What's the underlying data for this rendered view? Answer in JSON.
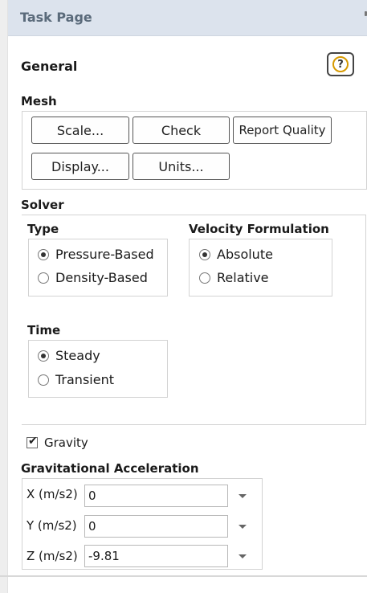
{
  "panel": {
    "title": "Task Page"
  },
  "general": {
    "title": "General",
    "help_symbol": "?"
  },
  "mesh": {
    "title": "Mesh",
    "buttons": [
      "Scale...",
      "Check",
      "Report Quality",
      "Display...",
      "Units..."
    ]
  },
  "solver": {
    "title": "Solver",
    "type": {
      "title": "Type",
      "options": [
        "Pressure-Based",
        "Density-Based"
      ],
      "selected": "Pressure-Based"
    },
    "velocity": {
      "title": "Velocity Formulation",
      "options": [
        "Absolute",
        "Relative"
      ],
      "selected": "Absolute"
    },
    "time": {
      "title": "Time",
      "options": [
        "Steady",
        "Transient"
      ],
      "selected": "Steady"
    }
  },
  "gravity": {
    "label": "Gravity",
    "checked": true
  },
  "grav_accel": {
    "title": "Gravitational Acceleration",
    "fields": [
      {
        "label": "X (m/s2)",
        "value": "0"
      },
      {
        "label": "Y (m/s2)",
        "value": "0"
      },
      {
        "label": "Z (m/s2)",
        "value": "-9.81"
      }
    ]
  },
  "icons": {
    "help": "help-icon",
    "dropdown": "chevron-down-icon",
    "check": "checkmark-icon"
  },
  "colors": {
    "header_bg": "#dce3ed",
    "help_ring": "#d79a00"
  }
}
